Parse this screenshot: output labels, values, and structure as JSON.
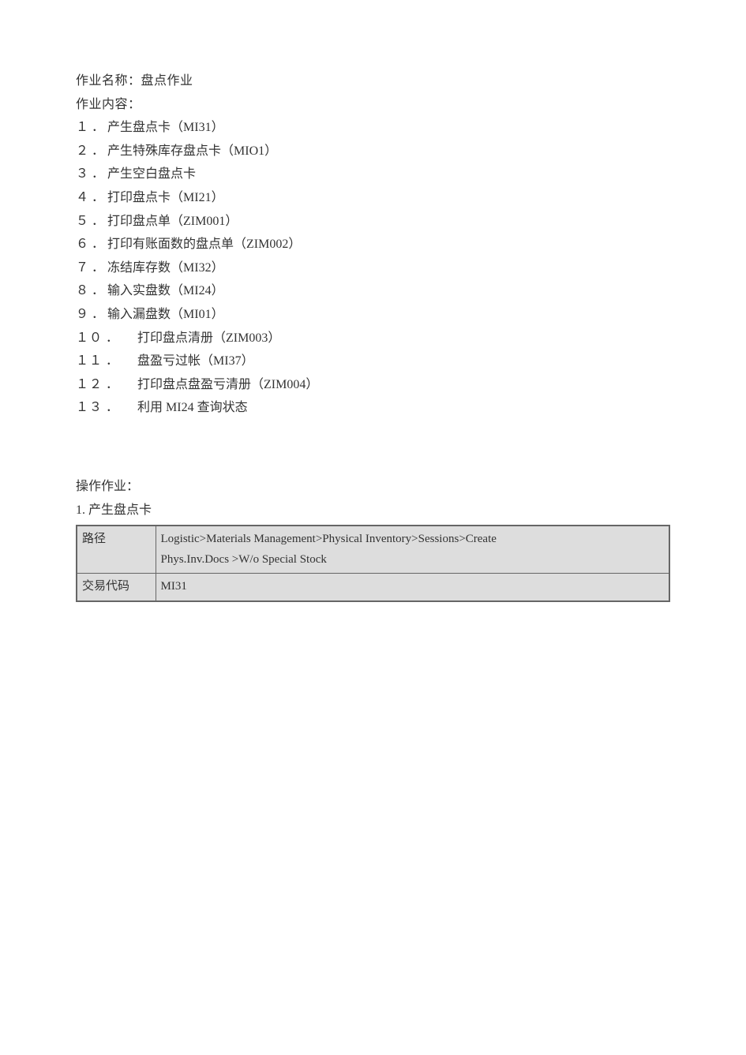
{
  "header": {
    "task_name_label": "作业名称：",
    "task_name_value": "盘点作业",
    "task_content_label": "作业内容："
  },
  "items": [
    {
      "num": "１",
      "txt": "产生盘点卡（MI31）"
    },
    {
      "num": "２",
      "txt": "产生特殊库存盘点卡（MIO1）"
    },
    {
      "num": "３",
      "txt": "产生空白盘点卡"
    },
    {
      "num": "４",
      "txt": "打印盘点卡（MI21）"
    },
    {
      "num": "５",
      "txt": "打印盘点单（ZIM001）"
    },
    {
      "num": "６",
      "txt": "打印有账面数的盘点单（ZIM002）"
    },
    {
      "num": "７",
      "txt": "冻结库存数（MI32）"
    },
    {
      "num": "８",
      "txt": "输入实盘数（MI24）"
    },
    {
      "num": "９",
      "txt": "输入漏盘数（MI01）"
    },
    {
      "num": "１０",
      "txt": "打印盘点清册（ZIM003）"
    },
    {
      "num": "１１",
      "txt": "盘盈亏过帐（MI37）"
    },
    {
      "num": "１２",
      "txt": "打印盘点盘盈亏清册（ZIM004）"
    },
    {
      "num": "１３",
      "txt": "利用 MI24  查询状态"
    }
  ],
  "operation": {
    "label": "操作作业：",
    "step_prefix": "1. ",
    "step_title": "产生盘点卡",
    "table": {
      "row1_key": "路径",
      "row1_val_line1": "Logistic>Materials  Management>Physical  Inventory>Sessions>Create",
      "row1_val_line2": "Phys.Inv.Docs >W/o  Special  Stock",
      "row2_key": "交易代码",
      "row2_val": "MI31"
    }
  }
}
